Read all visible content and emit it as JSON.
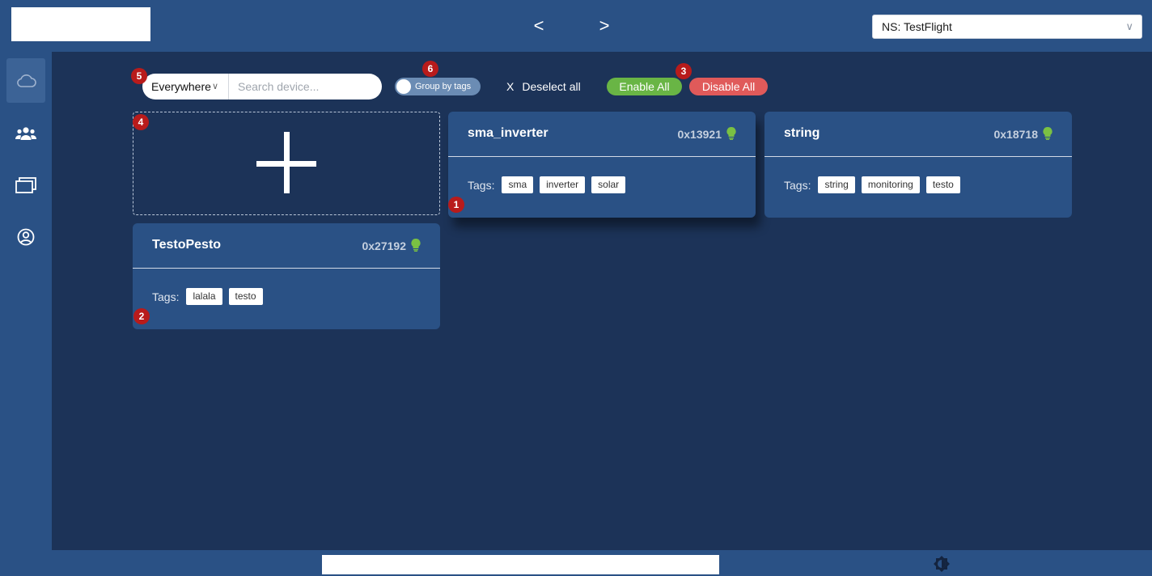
{
  "header": {
    "prev_arrow": "<",
    "next_arrow": ">",
    "namespace": "NS: TestFlight"
  },
  "sidebar": {
    "items": [
      {
        "icon": "cloud-icon",
        "active": true
      },
      {
        "icon": "users-icon",
        "active": false
      },
      {
        "icon": "folders-icon",
        "active": false
      },
      {
        "icon": "user-circle-icon",
        "active": false
      }
    ]
  },
  "toolbar": {
    "scope_value": "Everywhere",
    "search_placeholder": "Search device...",
    "group_by_tags_label": "Group by tags",
    "group_by_tags_on": false,
    "deselect_icon": "X",
    "deselect_label": "Deselect all",
    "enable_all_label": "Enable All",
    "disable_all_label": "Disable All"
  },
  "devices": [
    {
      "name": "sma_inverter",
      "address": "0x13921",
      "status": "online",
      "tags_label": "Tags:",
      "tags": [
        "sma",
        "inverter",
        "solar"
      ]
    },
    {
      "name": "string",
      "address": "0x18718",
      "status": "online",
      "tags_label": "Tags:",
      "tags": [
        "string",
        "monitoring",
        "testo"
      ]
    },
    {
      "name": "TestoPesto",
      "address": "0x27192",
      "status": "online",
      "tags_label": "Tags:",
      "tags": [
        "lalala",
        "testo"
      ]
    }
  ],
  "markers": [
    "1",
    "2",
    "3",
    "4",
    "5",
    "6"
  ],
  "colors": {
    "background": "#1c3358",
    "bar": "#2a5185",
    "card": "#2a5185",
    "enable": "#69b545",
    "disable": "#e05a5a",
    "status_online": "#7ac143",
    "marker": "#b81b1b"
  }
}
